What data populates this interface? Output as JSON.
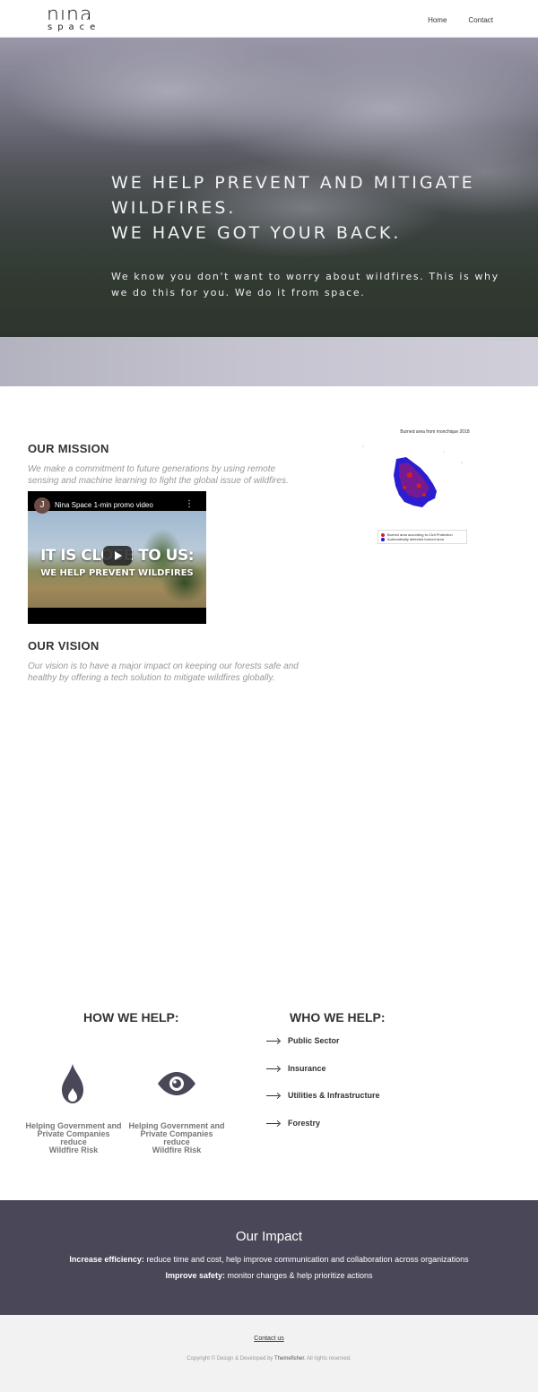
{
  "header": {
    "logo_top": "nina",
    "logo_bottom": "space",
    "nav": [
      {
        "label": "Home"
      },
      {
        "label": "Contact"
      }
    ]
  },
  "hero": {
    "title_line1": "WE HELP PREVENT AND MITIGATE WILDFIRES.",
    "title_line2": "WE HAVE GOT YOUR BACK.",
    "subtitle": "We know you don't want to worry about wildfires. This is why we do this for you. We do it from space."
  },
  "mission": {
    "title": "OUR MISSION",
    "text": "We make a commitment to future generations by using remote sensing and machine learning to fight the global issue of wildfires."
  },
  "video": {
    "channel_initial": "J",
    "title": "Nina Space 1-min promo video",
    "overlay_big": "IT IS CLOSE TO US:",
    "overlay_small": "WE HELP PREVENT WILDFIRES"
  },
  "vision": {
    "title": "OUR VISION",
    "text": "Our vision is to have a major impact on keeping our forests safe and healthy by offering a tech solution to mitigate wildfires globally."
  },
  "map_figure": {
    "caption": "Burned area from monchique 2018",
    "legend": [
      {
        "label": "Burned area according to Civil Protection",
        "color": "#d62020"
      },
      {
        "label": "Automatically detected burned area",
        "color": "#1a1acc"
      }
    ]
  },
  "how": {
    "title": "HOW WE HELP:",
    "items": [
      {
        "icon": "fire-icon",
        "label_l1": "Helping Government and",
        "label_l2": "Private Companies reduce",
        "label_l3": "Wildfire Risk"
      },
      {
        "icon": "eye-icon",
        "label_l1": "Helping Government and",
        "label_l2": "Private Companies reduce",
        "label_l3": "Wildfire Risk"
      }
    ]
  },
  "who": {
    "title": "WHO WE HELP:",
    "items": [
      "Public Sector",
      "Insurance",
      "Utilities & Infrastructure",
      "Forestry"
    ]
  },
  "impact": {
    "title": "Our Impact",
    "line1_bold": "Increase efficiency:",
    "line1_text": " reduce time and cost, help improve communication and collaboration across organizations",
    "line2_bold": "Improve safety:",
    "line2_text": " monitor changes & help prioritize actions"
  },
  "footer": {
    "contact_label": "Contact us",
    "copyright_prefix": "Copyright © Design & Developed by ",
    "copyright_brand": "Themefisher",
    "copyright_suffix": ". All rights reserved."
  },
  "colors": {
    "impact_bg": "#4a4758",
    "footer_bg": "#f2f2f2"
  }
}
